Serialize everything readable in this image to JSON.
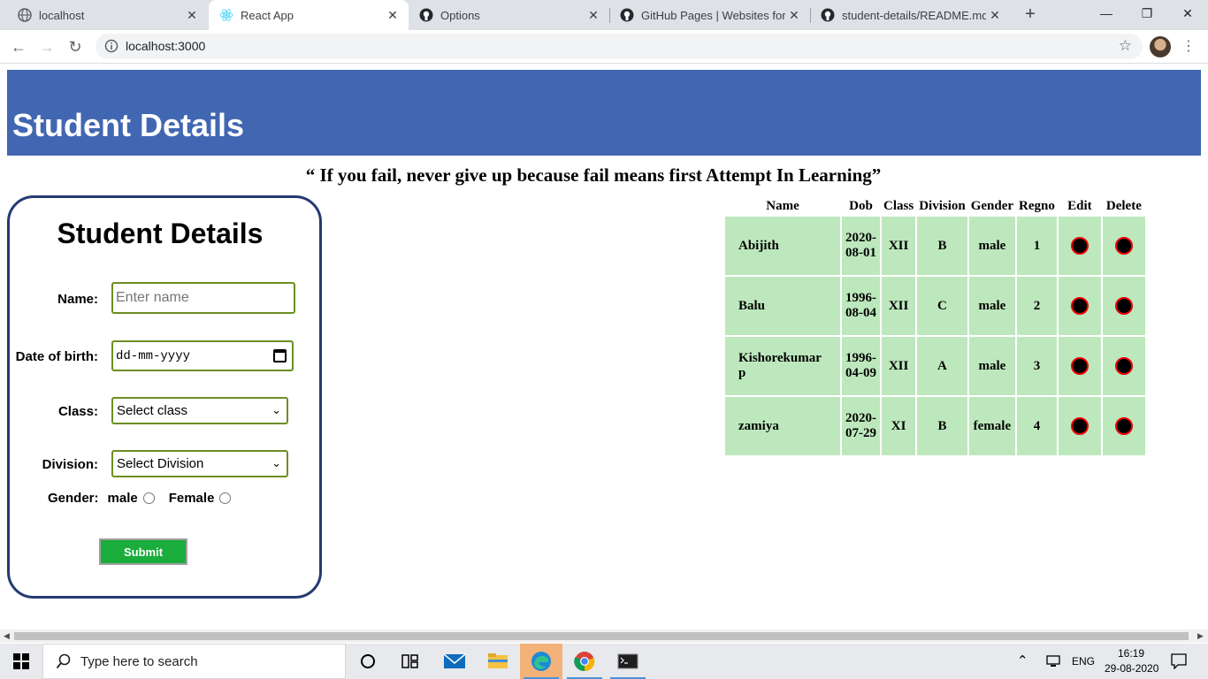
{
  "browser": {
    "tabs": [
      {
        "title": "localhost",
        "icon": "globe-icon",
        "active": false
      },
      {
        "title": "React App",
        "icon": "react-icon",
        "active": true
      },
      {
        "title": "Options",
        "icon": "github-icon",
        "active": false
      },
      {
        "title": "GitHub Pages | Websites for yo",
        "icon": "github-icon",
        "active": false
      },
      {
        "title": "student-details/README.md at",
        "icon": "github-icon",
        "active": false
      }
    ],
    "url": "localhost:3000"
  },
  "page": {
    "banner_title": "Student Details",
    "quote": "“ If you fail, never give up because fail means first Attempt In Learning”",
    "form": {
      "title": "Student Details",
      "name_label": "Name:",
      "name_placeholder": "Enter name",
      "dob_label": "Date of birth:",
      "dob_placeholder": "dd-mm-yyyy",
      "class_label": "Class:",
      "class_selected": "Select class",
      "division_label": "Division:",
      "division_selected": "Select Division",
      "gender_label": "Gender:",
      "gender_options": [
        "male",
        "Female"
      ],
      "submit_label": "Submit"
    },
    "table": {
      "headers": [
        "Name",
        "Dob",
        "Class",
        "Division",
        "Gender",
        "Regno",
        "Edit",
        "Delete"
      ],
      "rows": [
        {
          "name": "Abijith",
          "dob": "2020-\n08-01",
          "class": "XII",
          "division": "B",
          "gender": "male",
          "regno": "1"
        },
        {
          "name": "Balu",
          "dob": "1996-\n08-04",
          "class": "XII",
          "division": "C",
          "gender": "male",
          "regno": "2"
        },
        {
          "name": "Kishorekumar\np",
          "dob": "1996-\n04-09",
          "class": "XII",
          "division": "A",
          "gender": "male",
          "regno": "3"
        },
        {
          "name": "zamiya",
          "dob": "2020-\n07-29",
          "class": "XI",
          "division": "B",
          "gender": "female",
          "regno": "4"
        }
      ]
    }
  },
  "taskbar": {
    "search_placeholder": "Type here to search",
    "language": "ENG",
    "time": "16:19",
    "date": "29-08-2020"
  },
  "colors": {
    "banner": "#4267b2",
    "card_border": "#243a73",
    "table_cell": "#bde8bd",
    "submit": "#1aad3c",
    "input_border": "#6b8e23"
  }
}
